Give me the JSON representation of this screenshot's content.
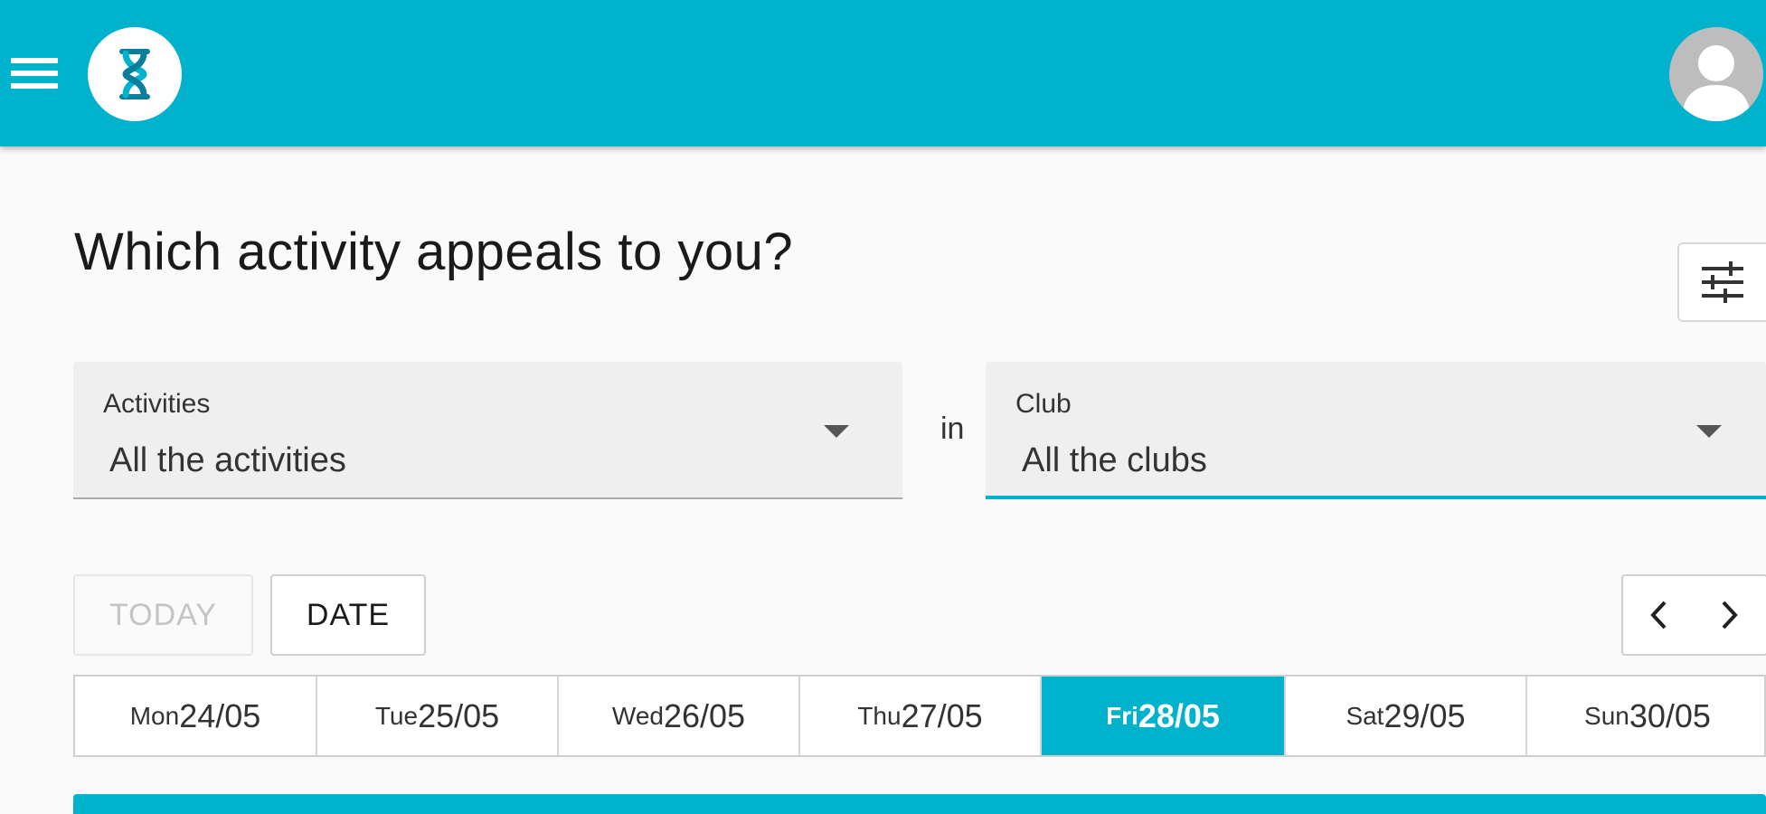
{
  "header": {
    "menu_icon": "hamburger-menu-icon",
    "logo_icon": "hourglass-logo-icon",
    "avatar_icon": "user-avatar-icon",
    "brand_color": "#00b2cc"
  },
  "main": {
    "title": "Which activity appeals to you?",
    "filter_icon": "tune-sliders-icon"
  },
  "filters": {
    "activities": {
      "label": "Activities",
      "value": "All the activities"
    },
    "connector": "in",
    "club": {
      "label": "Club",
      "value": "All the clubs"
    }
  },
  "date_controls": {
    "today_label": "TODAY",
    "date_label": "DATE",
    "prev_icon": "chevron-left-icon",
    "next_icon": "chevron-right-icon"
  },
  "days": [
    {
      "dow": "Mon",
      "dm": "24/05",
      "active": false
    },
    {
      "dow": "Tue",
      "dm": "25/05",
      "active": false
    },
    {
      "dow": "Wed",
      "dm": "26/05",
      "active": false
    },
    {
      "dow": "Thu",
      "dm": "27/05",
      "active": false
    },
    {
      "dow": "Fri",
      "dm": "28/05",
      "active": true
    },
    {
      "dow": "Sat",
      "dm": "29/05",
      "active": false
    },
    {
      "dow": "Sun",
      "dm": "30/05",
      "active": false
    }
  ]
}
